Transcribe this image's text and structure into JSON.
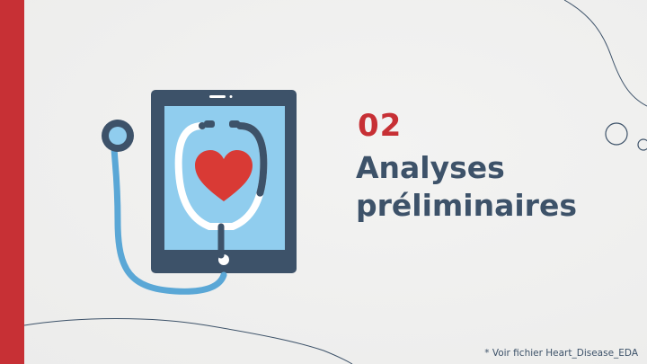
{
  "slide": {
    "number": "02",
    "title_line1": "Analyses",
    "title_line2": "préliminaires",
    "footnote": "* Voir fichier Heart_Disease_EDA"
  },
  "colors": {
    "accent": "#c73035",
    "navy": "#3d5269",
    "tablet_screen": "#90cdee",
    "stethoscope_blue": "#5aa7d6",
    "heart": "#d93a35"
  },
  "illustration": {
    "icon": "tablet-stethoscope-heart-icon"
  }
}
